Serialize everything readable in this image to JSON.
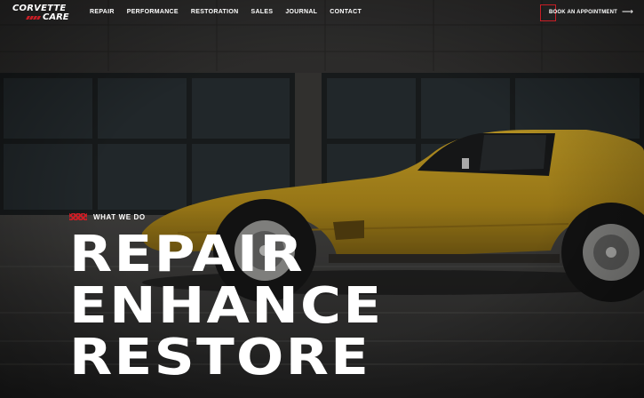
{
  "logo": {
    "line1": "CORVETTE",
    "line2": "CARE"
  },
  "nav": {
    "items": [
      {
        "label": "REPAIR"
      },
      {
        "label": "PERFORMANCE"
      },
      {
        "label": "RESTORATION"
      },
      {
        "label": "SALES"
      },
      {
        "label": "JOURNAL"
      },
      {
        "label": "CONTACT"
      }
    ]
  },
  "cta": {
    "label": "BOOK AN APPOINTMENT",
    "icon": "arrow-right-icon"
  },
  "hero": {
    "eyebrow": "WHAT WE DO",
    "headline": [
      "REPAIR",
      "ENHANCE",
      "RESTORE"
    ]
  },
  "colors": {
    "accent": "#c81d25",
    "car": "#c39a1f",
    "background": "#2b2b2b"
  }
}
